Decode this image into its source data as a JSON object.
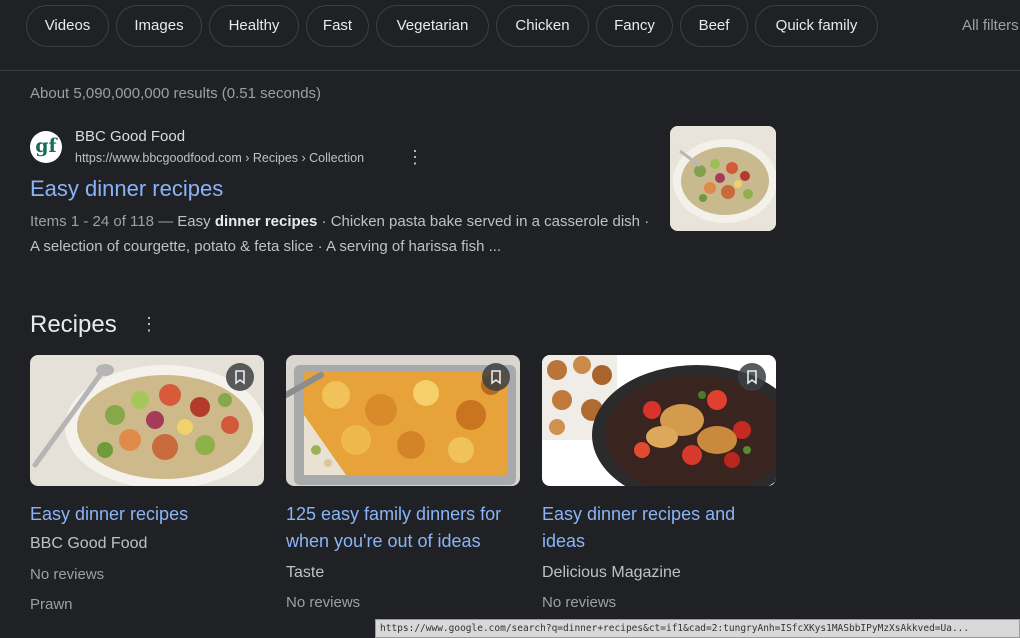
{
  "chips": [
    {
      "label": "Videos"
    },
    {
      "label": "Images"
    },
    {
      "label": "Healthy"
    },
    {
      "label": "Fast"
    },
    {
      "label": "Vegetarian"
    },
    {
      "label": "Chicken"
    },
    {
      "label": "Fancy"
    },
    {
      "label": "Beef"
    },
    {
      "label": "Quick family"
    }
  ],
  "all_filters": "All filters",
  "stats": "About 5,090,000,000 results (0.51 seconds)",
  "result": {
    "favicon_text": "gf",
    "site_name": "BBC Good Food",
    "url": "https://www.bbcgoodfood.com › Recipes › Collection",
    "title": "Easy dinner recipes",
    "snippet_meta": "Items 1 - 24 of 118 — ",
    "snippet_pre": "Easy ",
    "snippet_bold": "dinner recipes",
    "snippet_post": " · Chicken pasta bake served in a casserole dish · A selection of courgette, potato & feta slice · A serving of harissa fish ..."
  },
  "recipes": {
    "heading": "Recipes",
    "cards": [
      {
        "title": "Easy dinner recipes",
        "source": "BBC Good Food",
        "reviews": "No reviews",
        "extra": "Prawn"
      },
      {
        "title": "125 easy family dinners for when you're out of ideas",
        "source": "Taste",
        "reviews": "No reviews"
      },
      {
        "title": "Easy dinner recipes and ideas",
        "source": "Delicious Magazine",
        "reviews": "No reviews"
      }
    ]
  },
  "status_url": "https://www.google.com/search?q=dinner+recipes&ct=if1&cad=2:tungryAnh=ISfcXKys1MASbbIPyMzXsAkkved=Ua...",
  "colors": {
    "background": "#202124",
    "link": "#8ab4f8",
    "text": "#bdc1c6"
  }
}
